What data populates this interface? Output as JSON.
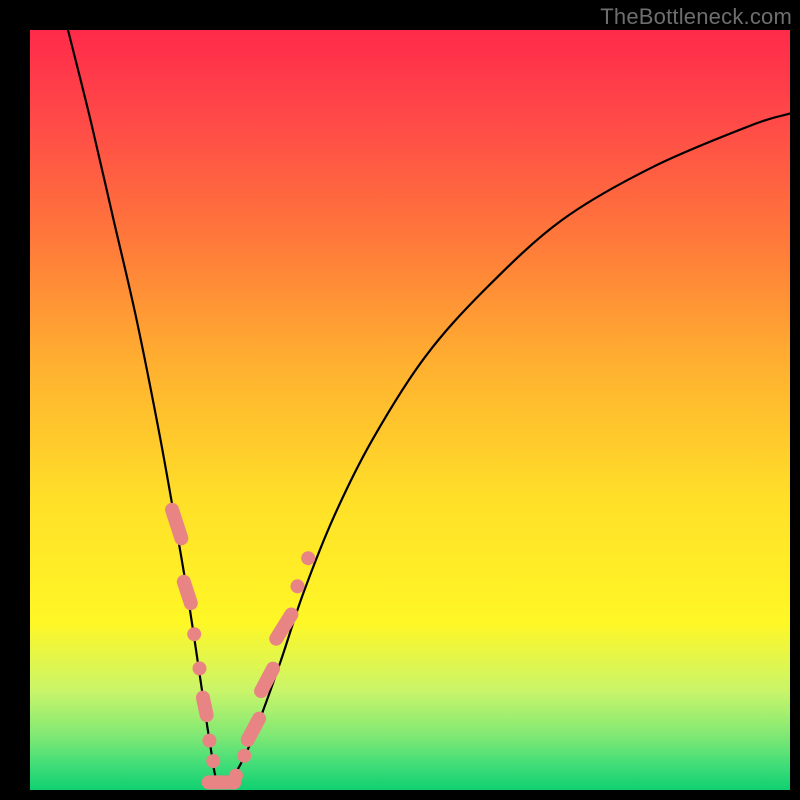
{
  "attribution": "TheBottleneck.com",
  "colors": {
    "marker": "#e98484",
    "curve": "#000000",
    "frame": "#000000"
  },
  "chart_data": {
    "type": "line",
    "title": "",
    "xlabel": "",
    "ylabel": "",
    "xlim": [
      0,
      100
    ],
    "ylim": [
      0,
      100
    ],
    "note": "V-shaped bottleneck curve; y≈0 near x≈25, rising steeply toward both x-extremes. Axes have no tick labels; values are read from the normalized 0–100 plot box.",
    "series": [
      {
        "name": "bottleneck-curve",
        "x": [
          5,
          8,
          11,
          14,
          17,
          19.5,
          21,
          22.5,
          23.7,
          24.7,
          26.5,
          28.5,
          30.5,
          33,
          36,
          40,
          45,
          52,
          60,
          70,
          82,
          95,
          100
        ],
        "y": [
          100,
          88,
          75,
          62,
          47,
          33,
          24,
          14,
          6,
          1,
          1.5,
          5,
          10,
          17,
          26,
          36,
          46,
          57,
          66,
          75,
          82,
          87.5,
          89
        ]
      }
    ],
    "markers": {
      "name": "highlighted-points",
      "shape": "pill-and-dot",
      "points": [
        {
          "x": 19.3,
          "y": 35,
          "kind": "pill",
          "angle": -72,
          "len": 5.8
        },
        {
          "x": 20.7,
          "y": 26,
          "kind": "pill",
          "angle": -72,
          "len": 4.8
        },
        {
          "x": 21.6,
          "y": 20.5,
          "kind": "dot"
        },
        {
          "x": 22.3,
          "y": 16,
          "kind": "dot"
        },
        {
          "x": 23.0,
          "y": 11,
          "kind": "pill",
          "angle": -78,
          "len": 4.2
        },
        {
          "x": 23.6,
          "y": 6.5,
          "kind": "dot"
        },
        {
          "x": 24.1,
          "y": 3.8,
          "kind": "dot"
        },
        {
          "x": 25.2,
          "y": 1.0,
          "kind": "pill",
          "angle": 0,
          "len": 5.2
        },
        {
          "x": 27.1,
          "y": 1.9,
          "kind": "dot"
        },
        {
          "x": 28.2,
          "y": 4.5,
          "kind": "dot"
        },
        {
          "x": 29.4,
          "y": 8.0,
          "kind": "pill",
          "angle": 62,
          "len": 5.0
        },
        {
          "x": 31.2,
          "y": 14.5,
          "kind": "pill",
          "angle": 62,
          "len": 5.2
        },
        {
          "x": 33.4,
          "y": 21.5,
          "kind": "pill",
          "angle": 58,
          "len": 5.6
        },
        {
          "x": 35.2,
          "y": 26.8,
          "kind": "dot"
        },
        {
          "x": 36.6,
          "y": 30.5,
          "kind": "dot"
        }
      ]
    }
  }
}
